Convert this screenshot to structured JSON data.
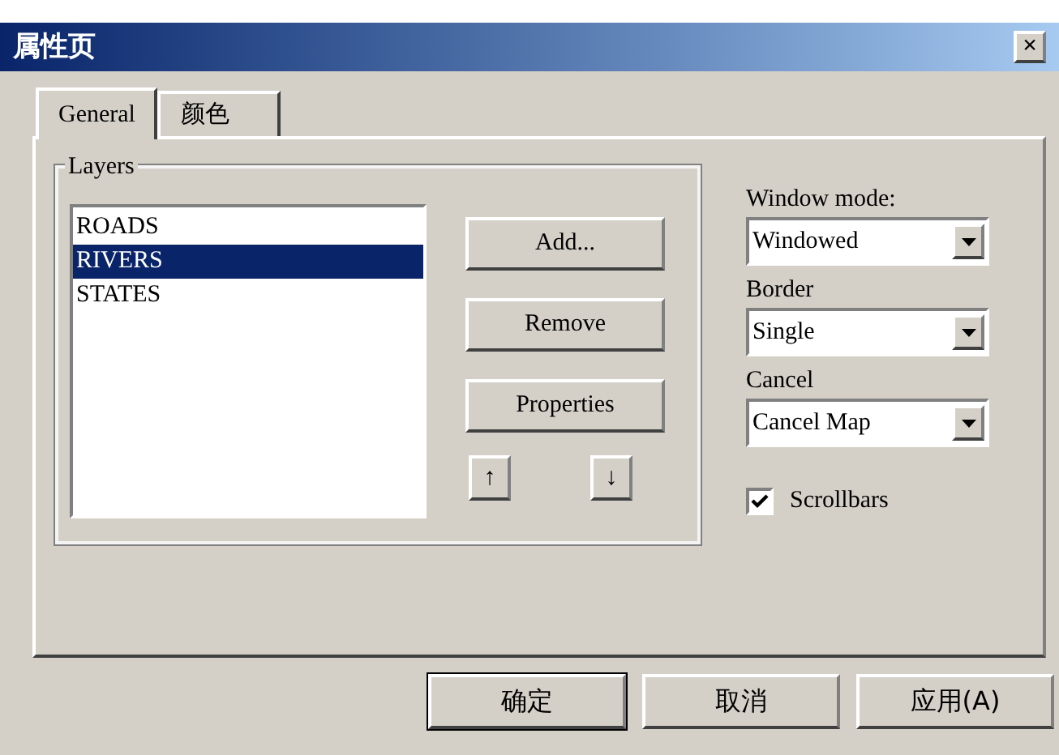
{
  "window": {
    "title": "属性页",
    "close": "×"
  },
  "tabs": [
    {
      "label": "General",
      "selected": true
    },
    {
      "label": "颜色",
      "selected": false
    }
  ],
  "layers": {
    "title": "Layers",
    "items": [
      {
        "label": "ROADS",
        "selected": false
      },
      {
        "label": "RIVERS",
        "selected": true
      },
      {
        "label": "STATES",
        "selected": false
      }
    ],
    "buttons": [
      "Add...",
      "Remove",
      "Properties"
    ],
    "move_up": "↑",
    "move_down": "↓"
  },
  "settings": [
    {
      "label": "Window mode:",
      "value": "Windowed"
    },
    {
      "label": "Border",
      "value": "Single"
    },
    {
      "label": "Cancel",
      "value": "Cancel Map"
    }
  ],
  "scrollbars": {
    "label": "Scrollbars",
    "checked": true
  },
  "footer_buttons": [
    {
      "label": "确定",
      "default": true
    },
    {
      "label": "取消",
      "default": false
    },
    {
      "label": "应用(A)",
      "default": false
    }
  ]
}
